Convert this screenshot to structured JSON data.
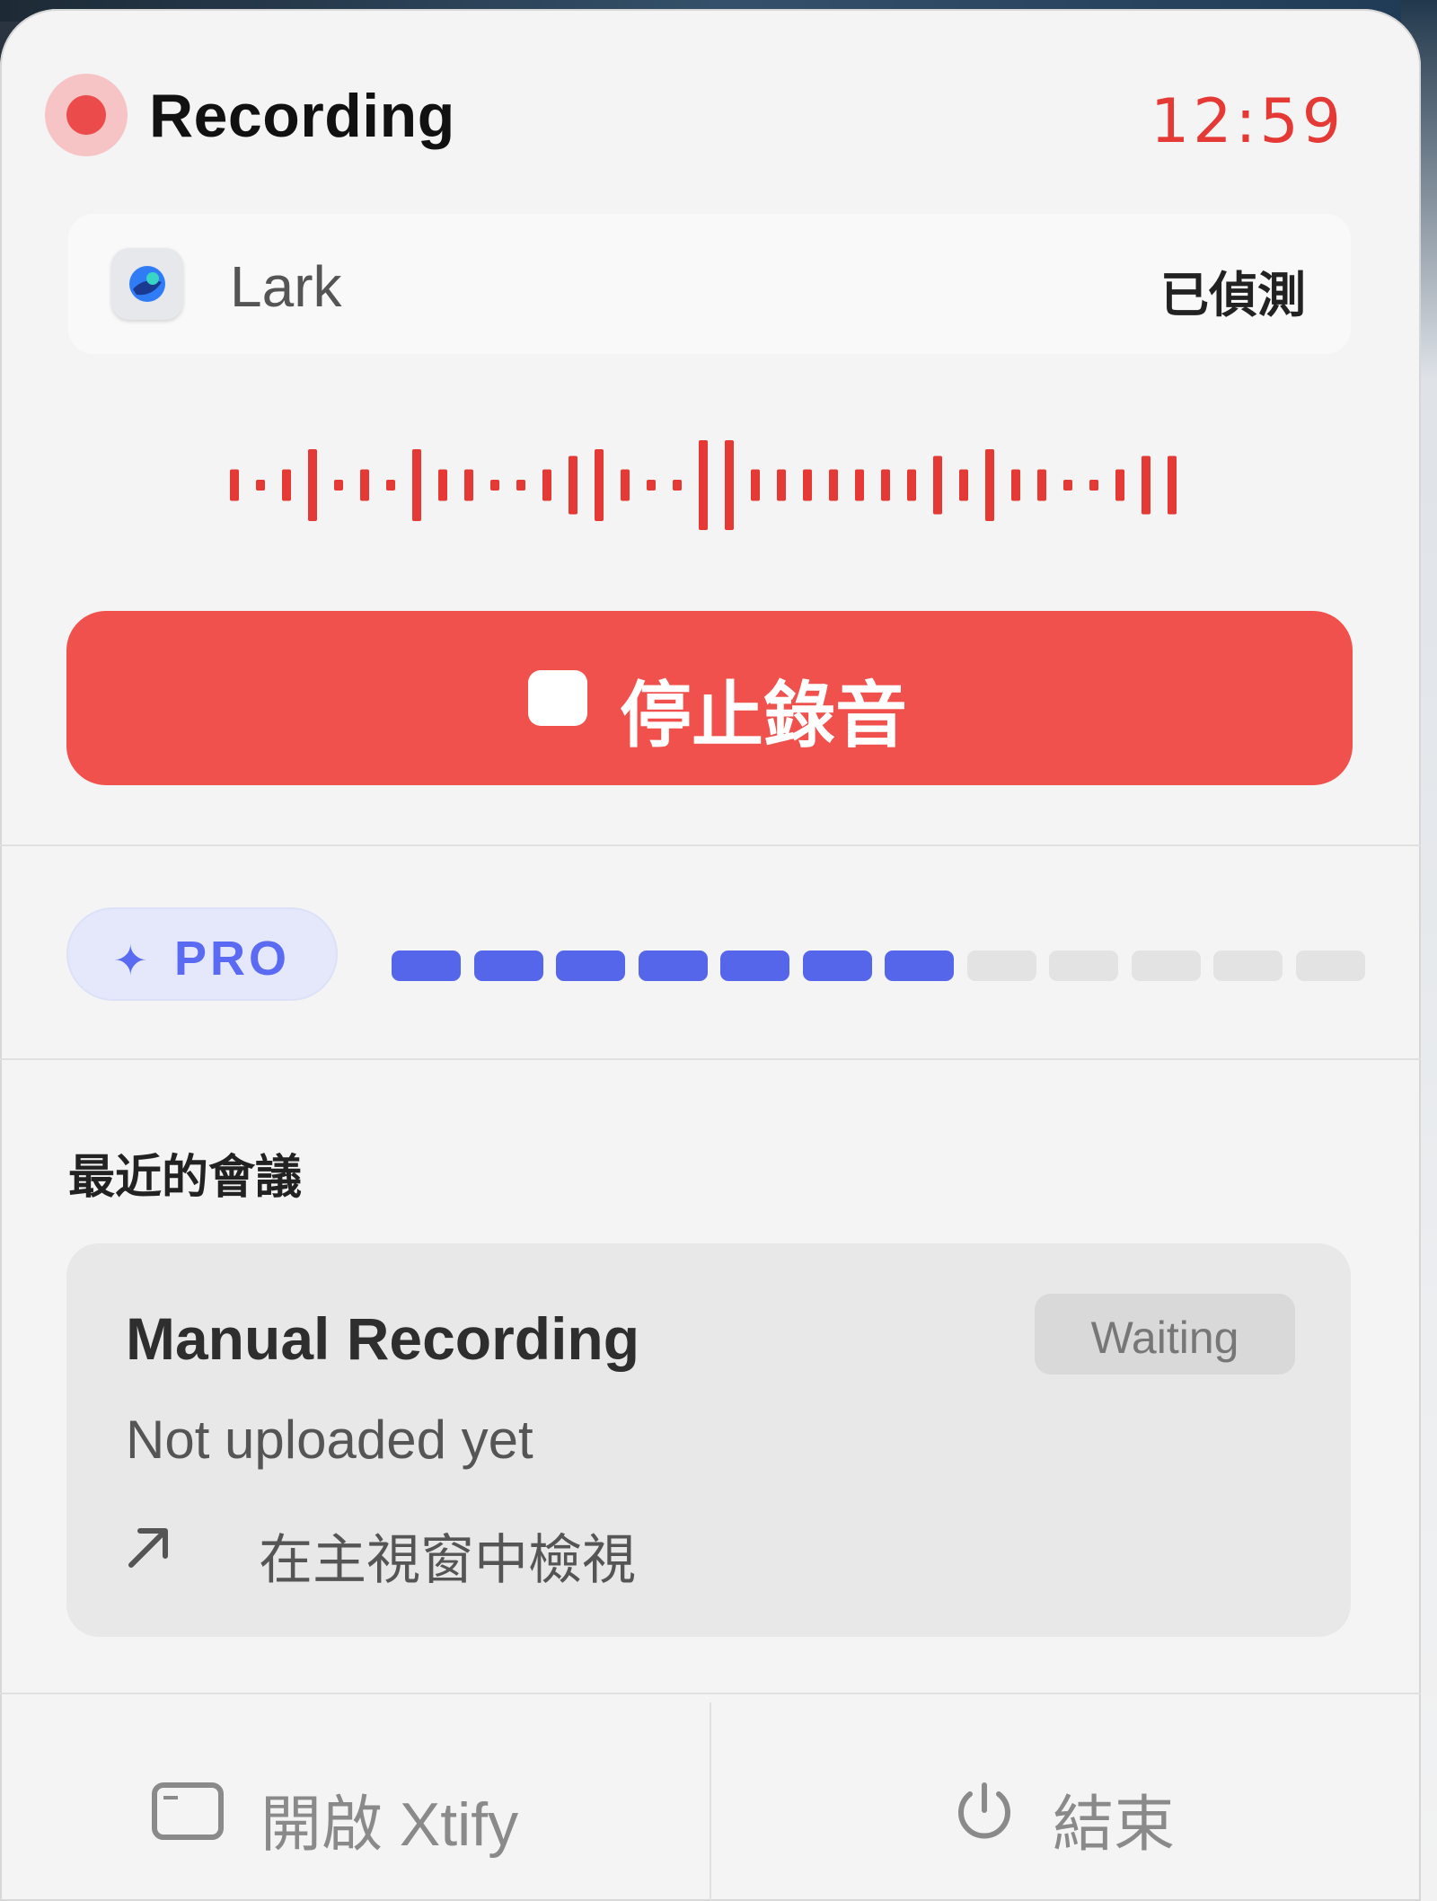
{
  "header": {
    "title": "Recording",
    "timer": "12:59",
    "accent_color": "#e53935"
  },
  "detected_app": {
    "icon": "lark-app-icon",
    "name": "Lark",
    "status": "已偵測"
  },
  "waveform": {
    "color": "#e53935",
    "levels": [
      0.35,
      0.12,
      0.35,
      0.8,
      0.12,
      0.35,
      0.12,
      0.8,
      0.35,
      0.35,
      0.12,
      0.12,
      0.35,
      0.65,
      0.8,
      0.35,
      0.12,
      0.12,
      1.0,
      1.0,
      0.35,
      0.35,
      0.35,
      0.35,
      0.35,
      0.35,
      0.35,
      0.65,
      0.35,
      0.8,
      0.35,
      0.35,
      0.12,
      0.12,
      0.35,
      0.65,
      0.65
    ]
  },
  "stop_button": {
    "label": "停止錄音",
    "icon": "stop-square-icon",
    "color": "#f0514c"
  },
  "plan": {
    "badge": "PRO",
    "badge_icon": "sparkle-icon",
    "quota_used": 7,
    "quota_total": 12,
    "accent_color": "#5666ea"
  },
  "recent": {
    "title": "最近的會議",
    "meetings": [
      {
        "title": "Manual Recording",
        "badge": "Waiting",
        "subtitle": "Not uploaded yet",
        "link_label": "在主視窗中檢視",
        "link_icon": "arrow-up-right-icon"
      }
    ]
  },
  "footer": {
    "open_label": "開啟 Xtify",
    "open_icon": "window-icon",
    "quit_label": "結束",
    "quit_icon": "power-icon"
  }
}
